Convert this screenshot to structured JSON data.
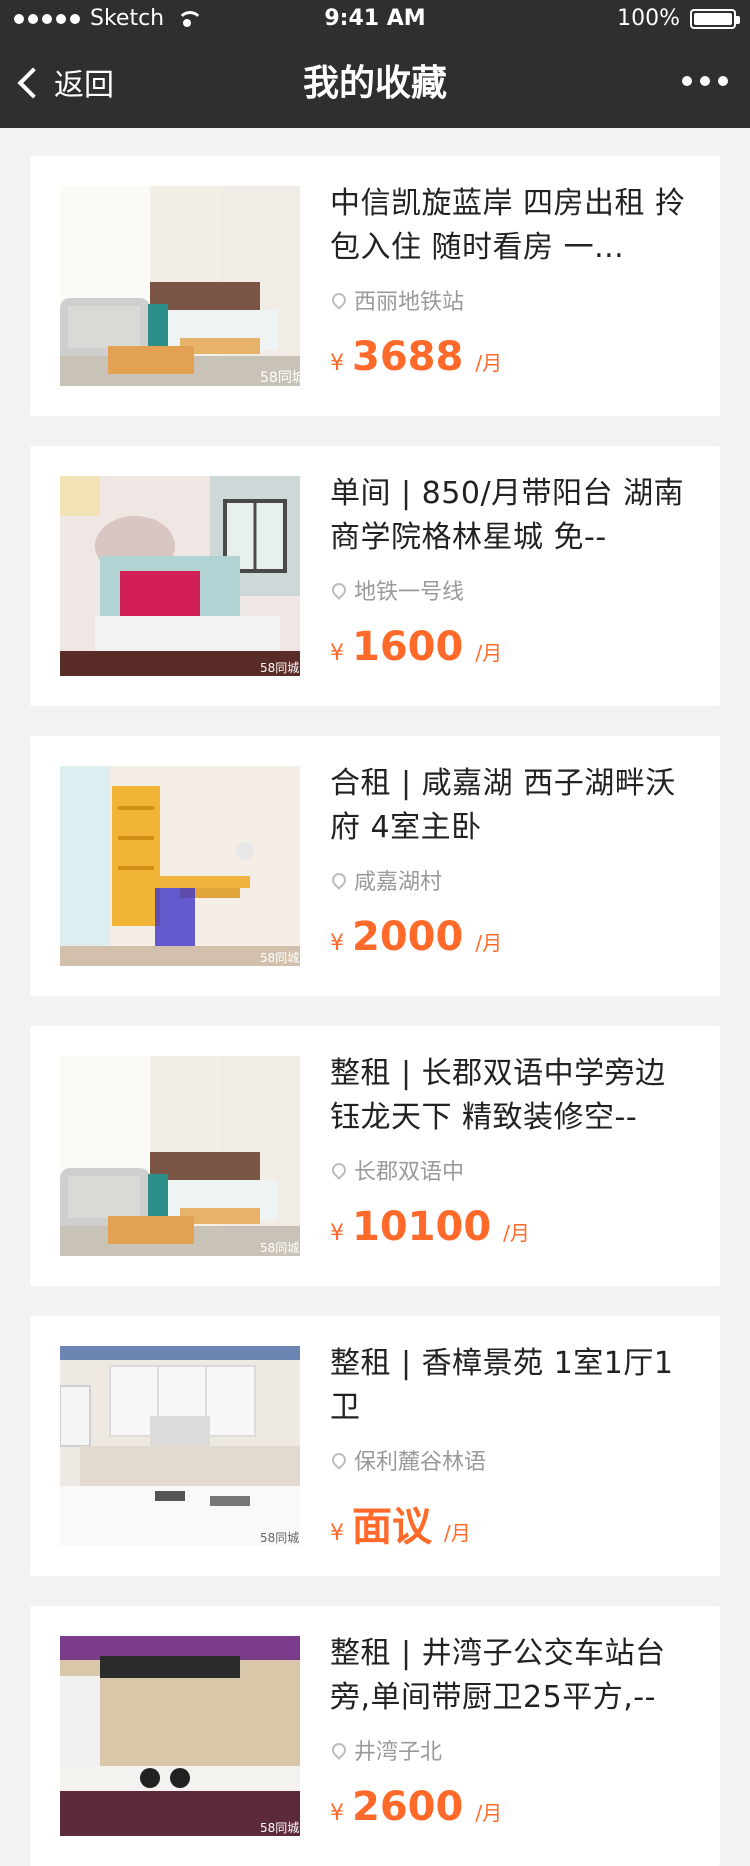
{
  "status_bar": {
    "carrier": "Sketch",
    "time": "9:41 AM",
    "battery": "100%"
  },
  "nav": {
    "back_label": "返回",
    "title": "我的收藏"
  },
  "colors": {
    "accent": "#ff6a2a",
    "header_bg": "#2f2f2f",
    "page_bg": "#f2f2f2"
  },
  "listings": [
    {
      "title": "中信凯旋蓝岸 四房出租 拎包入住 随时看房 一...",
      "location": "西丽地铁站",
      "currency": "¥",
      "price": "3688",
      "unit": "/月",
      "watermark": "58同城",
      "image": "bedroom-sofa-icon"
    },
    {
      "title": "单间 | 850/月带阳台 湖南商学院格林星城 免--",
      "location": "地铁一号线",
      "currency": "¥",
      "price": "1600",
      "unit": "/月",
      "watermark": "58同城",
      "image": "bedroom-bed-icon"
    },
    {
      "title": "合租 | 咸嘉湖 西子湖畔沃府 4室主卧",
      "location": "咸嘉湖村",
      "currency": "¥",
      "price": "2000",
      "unit": "/月",
      "watermark": "58同城",
      "image": "study-desk-icon"
    },
    {
      "title": "整租 | 长郡双语中学旁边 钰龙天下 精致装修空--",
      "location": "长郡双语中",
      "currency": "¥",
      "price": "10100",
      "unit": "/月",
      "watermark": "58同城",
      "image": "bedroom-sofa-icon"
    },
    {
      "title": "整租 | 香樟景苑 1室1厅1卫",
      "location": "保利麓谷林语",
      "currency": "¥",
      "price": "面议",
      "unit": "/月",
      "watermark": "58同城",
      "image": "kitchen-icon"
    },
    {
      "title": "整租 | 井湾子公交车站台旁,单间带厨卫25平方,--",
      "location": "井湾子北",
      "currency": "¥",
      "price": "2600",
      "unit": "/月",
      "watermark": "58同城",
      "image": "kitchen-stove-icon"
    }
  ]
}
